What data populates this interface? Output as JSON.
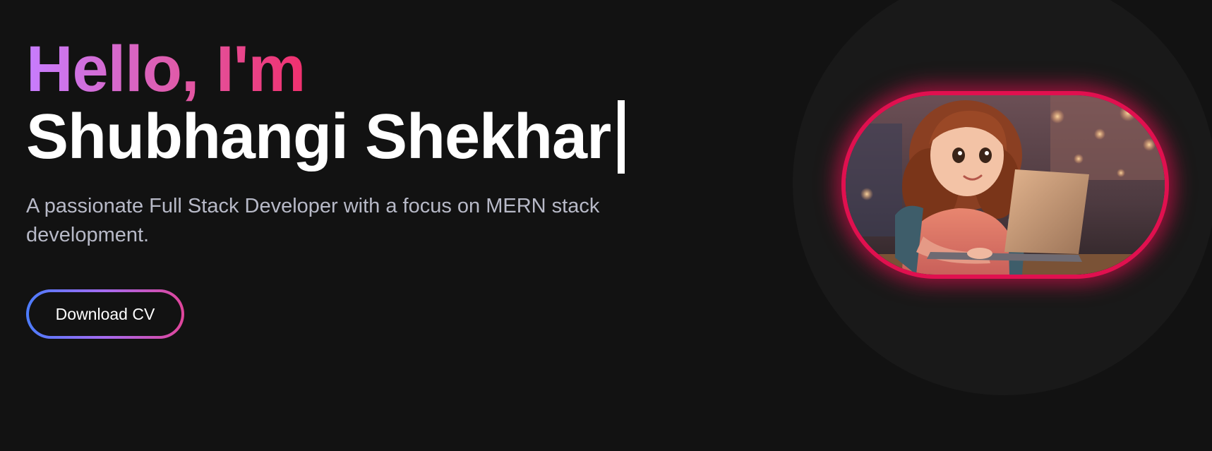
{
  "hero": {
    "greeting": "Hello, I'm",
    "name": "Shubhangi Shekhar",
    "tagline": "A passionate Full Stack Developer with a focus on MERN stack development.",
    "cta_label": "Download CV"
  },
  "avatar": {
    "description_icon": "avatar-illustration",
    "glow_color": "#e0104f"
  },
  "colors": {
    "background": "#121212",
    "greeting_gradient": [
      "#c77dff",
      "#e05aa8",
      "#f0306e"
    ],
    "button_border_gradient": [
      "#4b7cff",
      "#a66bf0",
      "#e0459a"
    ],
    "tagline": "#b7b9c7"
  }
}
